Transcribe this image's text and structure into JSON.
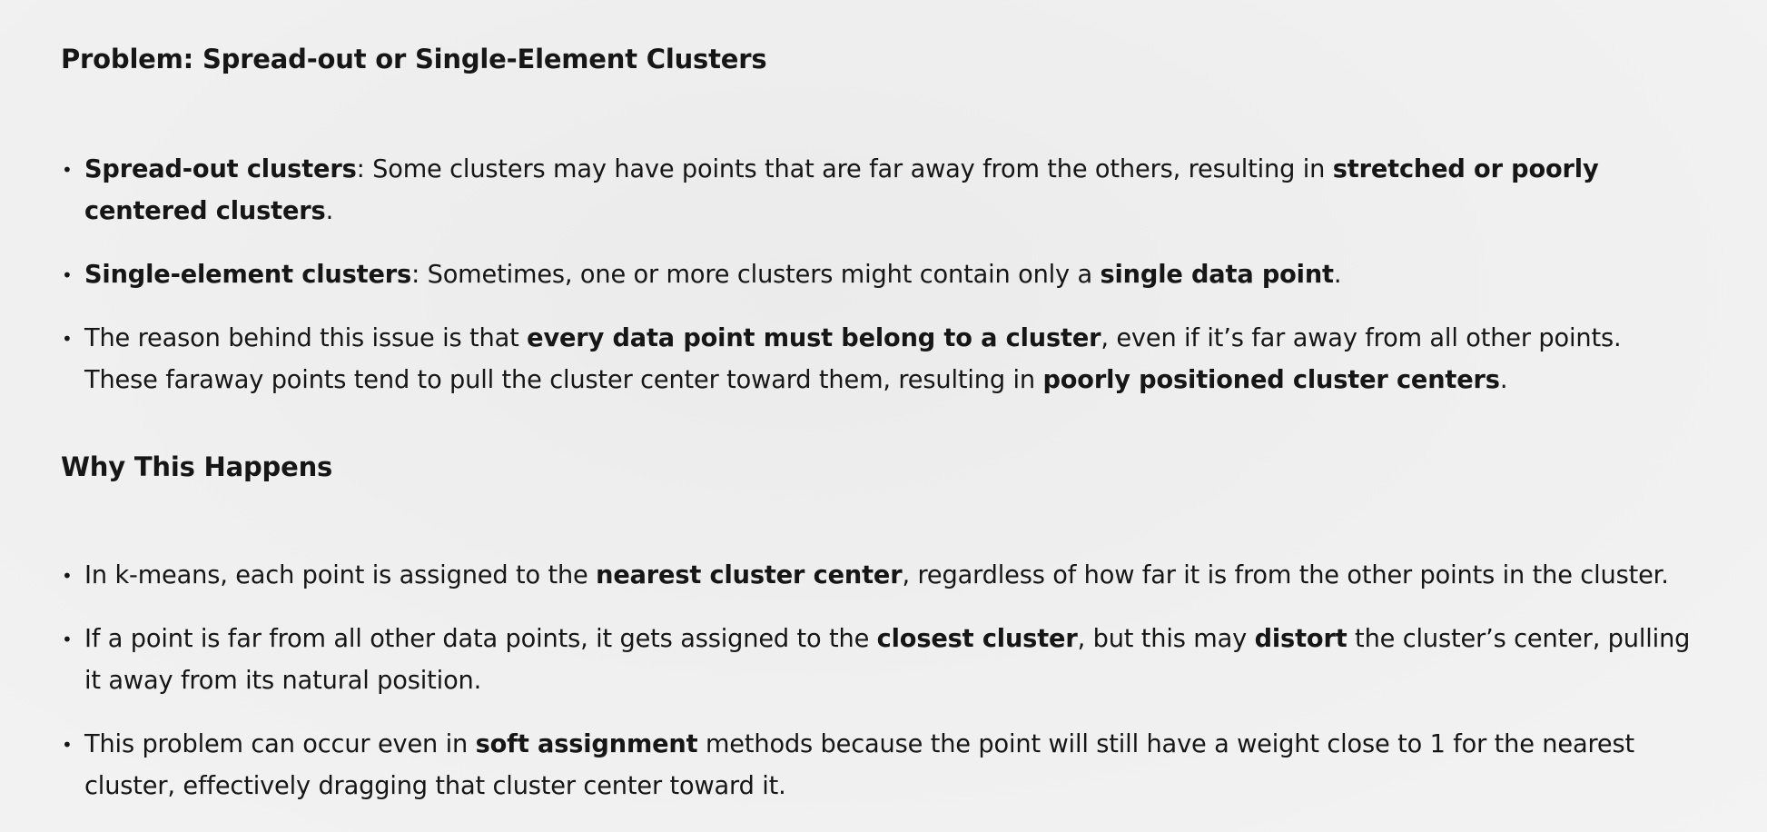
{
  "section1": {
    "heading": "Problem: Spread-out or Single-Element Clusters",
    "items": [
      [
        {
          "text": "Spread-out clusters",
          "bold": true
        },
        {
          "text": ": Some clusters may have points that are far away from the others, resulting in ",
          "bold": false
        },
        {
          "text": "stretched or poorly centered clusters",
          "bold": true
        },
        {
          "text": ".",
          "bold": false
        }
      ],
      [
        {
          "text": "Single-element clusters",
          "bold": true
        },
        {
          "text": ": Sometimes, one or more clusters might contain only a ",
          "bold": false
        },
        {
          "text": "single data point",
          "bold": true
        },
        {
          "text": ".",
          "bold": false
        }
      ],
      [
        {
          "text": "The reason behind this issue is that ",
          "bold": false
        },
        {
          "text": "every data point must belong to a cluster",
          "bold": true
        },
        {
          "text": ", even if it’s far away from all other points. These faraway points tend to pull the cluster center toward them, resulting in ",
          "bold": false
        },
        {
          "text": "poorly positioned cluster centers",
          "bold": true
        },
        {
          "text": ".",
          "bold": false
        }
      ]
    ]
  },
  "section2": {
    "heading": "Why This Happens",
    "items": [
      [
        {
          "text": "In k-means, each point is assigned to the ",
          "bold": false
        },
        {
          "text": "nearest cluster center",
          "bold": true
        },
        {
          "text": ", regardless of how far it is from the other points in the cluster.",
          "bold": false
        }
      ],
      [
        {
          "text": "If a point is far from all other data points, it gets assigned to the ",
          "bold": false
        },
        {
          "text": "closest cluster",
          "bold": true
        },
        {
          "text": ", but this may ",
          "bold": false
        },
        {
          "text": "distort",
          "bold": true
        },
        {
          "text": " the cluster’s center, pulling it away from its natural position.",
          "bold": false
        }
      ],
      [
        {
          "text": "This problem can occur even in ",
          "bold": false
        },
        {
          "text": "soft assignment",
          "bold": true
        },
        {
          "text": " methods because the point will still have a weight close to 1 for the nearest cluster, effectively dragging that cluster center toward it.",
          "bold": false
        }
      ]
    ]
  },
  "bullet_glyph": "•"
}
